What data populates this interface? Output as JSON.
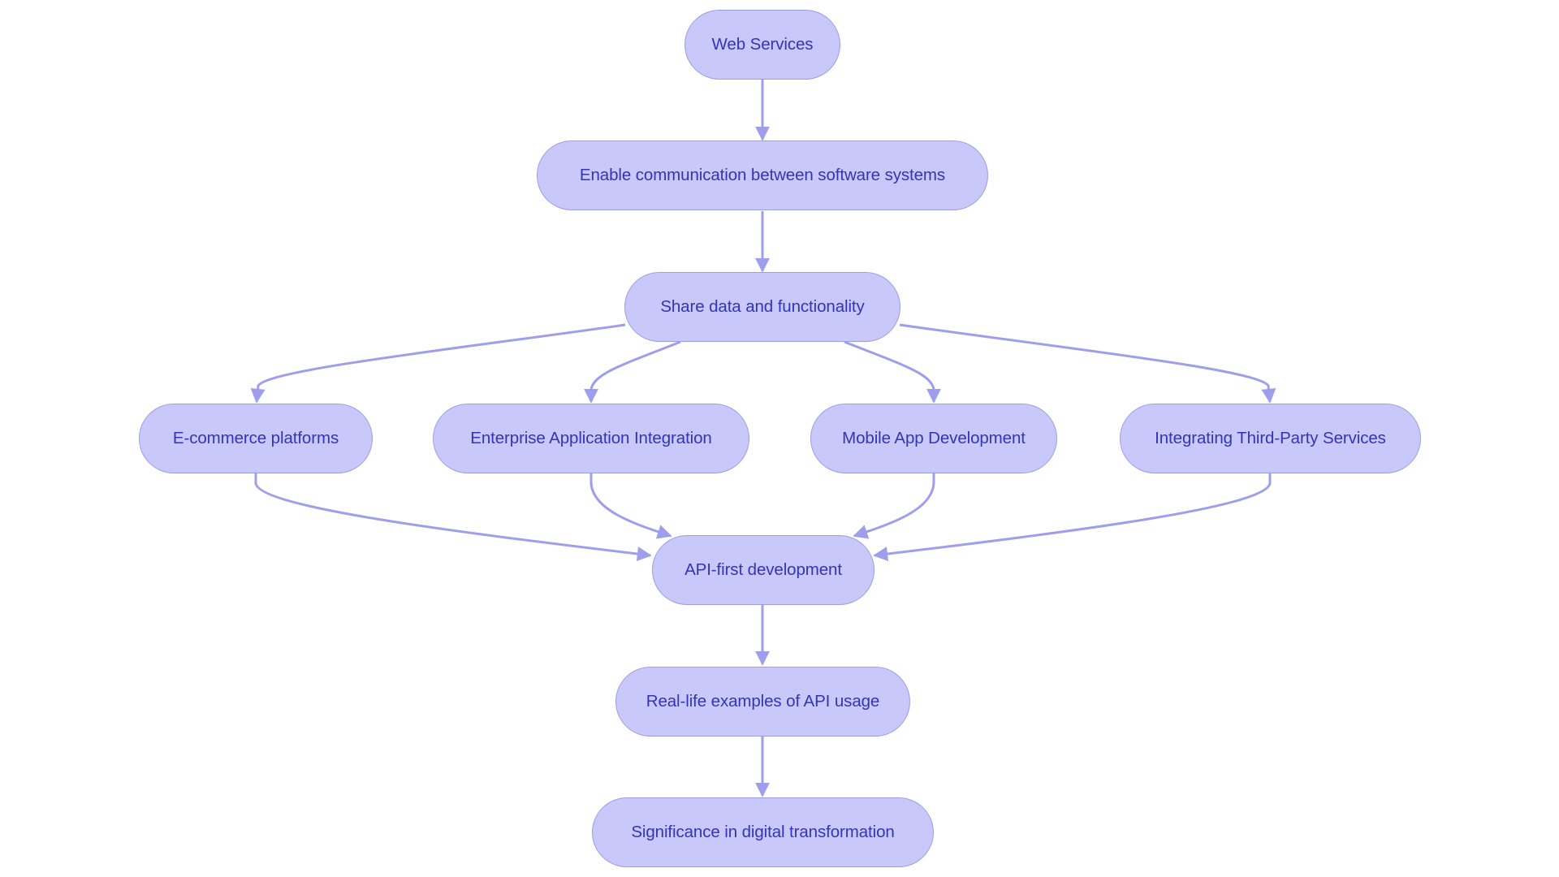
{
  "diagram": {
    "type": "flowchart",
    "direction": "top-to-bottom",
    "colors": {
      "node_fill": "#c8c8fa",
      "node_border": "#9d9de6",
      "node_text": "#3434b8",
      "edge": "#9e9eec",
      "background": "#ffffff"
    },
    "nodes": [
      {
        "id": "web_services",
        "label": "Web Services"
      },
      {
        "id": "enable_communication",
        "label": "Enable communication between software systems"
      },
      {
        "id": "share_data",
        "label": "Share data and functionality"
      },
      {
        "id": "ecommerce",
        "label": "E-commerce platforms"
      },
      {
        "id": "enterprise_integration",
        "label": "Enterprise Application Integration"
      },
      {
        "id": "mobile_app",
        "label": "Mobile App Development"
      },
      {
        "id": "third_party",
        "label": "Integrating Third-Party Services"
      },
      {
        "id": "api_first",
        "label": "API-first development"
      },
      {
        "id": "real_life_examples",
        "label": "Real-life examples of API usage"
      },
      {
        "id": "digital_transformation",
        "label": "Significance in digital transformation"
      }
    ],
    "edges": [
      {
        "from": "web_services",
        "to": "enable_communication"
      },
      {
        "from": "enable_communication",
        "to": "share_data"
      },
      {
        "from": "share_data",
        "to": "ecommerce"
      },
      {
        "from": "share_data",
        "to": "enterprise_integration"
      },
      {
        "from": "share_data",
        "to": "mobile_app"
      },
      {
        "from": "share_data",
        "to": "third_party"
      },
      {
        "from": "ecommerce",
        "to": "api_first"
      },
      {
        "from": "enterprise_integration",
        "to": "api_first"
      },
      {
        "from": "mobile_app",
        "to": "api_first"
      },
      {
        "from": "third_party",
        "to": "api_first"
      },
      {
        "from": "api_first",
        "to": "real_life_examples"
      },
      {
        "from": "real_life_examples",
        "to": "digital_transformation"
      }
    ]
  }
}
